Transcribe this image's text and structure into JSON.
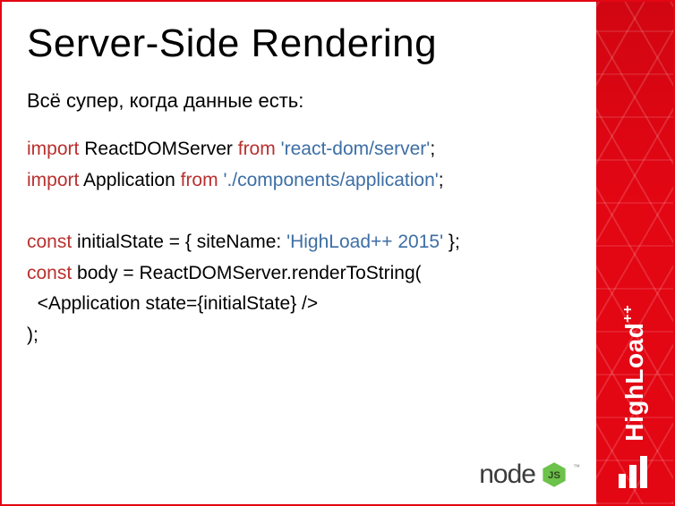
{
  "title": "Server-Side Rendering",
  "subtitle": "Всё супер, когда данные есть:",
  "code": {
    "l1": {
      "kw1": "import",
      "t1": " ReactDOMServer ",
      "kw2": "from",
      "t2": " ",
      "str": "'react-dom/server'",
      "t3": ";"
    },
    "l2": {
      "kw1": "import",
      "t1": " Application ",
      "kw2": "from",
      "t2": " ",
      "str": "'./components/application'",
      "t3": ";"
    },
    "l3": "",
    "l4": {
      "kw1": "const",
      "t1": " initialState = { siteName: ",
      "str": "'HighLoad++ 2015'",
      "t2": " };"
    },
    "l5": {
      "kw1": "const",
      "t1": " body = ReactDOMServer.renderToString("
    },
    "l6": {
      "t1": "  <Application state={initialState} />"
    },
    "l7": {
      "t1": ");"
    }
  },
  "footer": {
    "node_label": "node",
    "node_glyph": "JS",
    "tm": "™"
  },
  "brand": {
    "name": "HighLoad",
    "plus": "++"
  }
}
